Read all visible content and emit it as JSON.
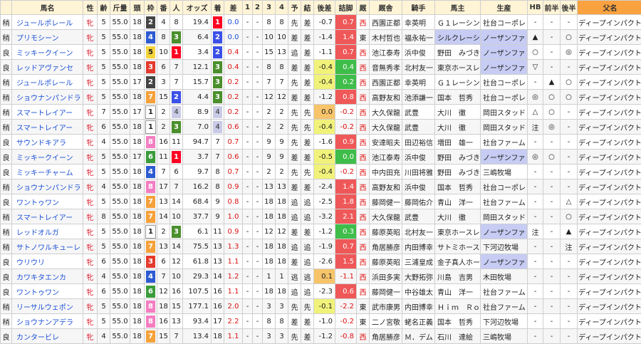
{
  "headers": [
    "馬名",
    "性",
    "齢",
    "斤量",
    "頭",
    "枠",
    "番",
    "人",
    "オッズ",
    "着",
    "差",
    "1",
    "2",
    "3",
    "4",
    "予",
    "結",
    "後差",
    "詰脚",
    "厩",
    "厩舎",
    "騎手",
    "馬主",
    "生産",
    "HB",
    "前半",
    "後半",
    "父名"
  ],
  "colors": {
    "waku": {
      "1": "#ffffff",
      "2": "#444444",
      "3": "#e53a2e",
      "4": "#2d5bd2",
      "5": "#f5d43a",
      "6": "#3a9c3a",
      "7": "#f6a13a",
      "8": "#f57ec2"
    }
  },
  "rows": [
    {
      "baba": "稍",
      "name": "ジュールポレール",
      "sex": "牝",
      "age": "5",
      "kin": "55.0",
      "tou": "18",
      "waku": "2",
      "ban": "4",
      "nin": "8",
      "odds": "19.4",
      "chaku": "1",
      "sa": "0.0",
      "c1": "-",
      "c2": "-",
      "c3": "8",
      "c4": "8",
      "yo": "先",
      "ke": "差",
      "atosa": "-0.7",
      "tsume": "0.7",
      "kyu": "西",
      "kyusha": "西園正都",
      "kishu": "幸英明",
      "banushi": "Ｇ１レーシン",
      "seisan": "社台コーポレ",
      "hb": "-",
      "zen": "-",
      "kou": "-",
      "chichi": "ディープインパクト"
    },
    {
      "baba": "稍",
      "name": "プリモシーン",
      "sex": "牝",
      "age": "5",
      "kin": "55.0",
      "tou": "18",
      "waku": "4",
      "ban": "8",
      "nin": "3",
      "odds": "6.4",
      "chaku": "2",
      "sa": "0.0",
      "c1": "-",
      "c2": "-",
      "c3": "10",
      "c4": "10",
      "yo": "差",
      "ke": "差",
      "atosa": "-1.4",
      "tsume": "1.4",
      "kyu": "東",
      "kyusha": "木村哲也",
      "kishu": "福永祐一",
      "banushi": "シルクレーシ",
      "seisan": "ノーザンファ",
      "hb": "▲",
      "zen": "-",
      "kou": "○",
      "chichi": "ディープインパクト"
    },
    {
      "baba": "良",
      "name": "ミッキークイーン",
      "sex": "牝",
      "age": "5",
      "kin": "55.0",
      "tou": "18",
      "waku": "5",
      "ban": "10",
      "nin": "1",
      "odds": "3.4",
      "chaku": "2",
      "sa": "0.4",
      "c1": "-",
      "c2": "-",
      "c3": "15",
      "c4": "13",
      "yo": "追",
      "ke": "差",
      "atosa": "-1.1",
      "tsume": "0.7",
      "kyu": "西",
      "kyusha": "池江泰寿",
      "kishu": "浜中俊",
      "banushi": "野田　みづき",
      "seisan": "ノーザンファ",
      "hb": "○",
      "zen": "-",
      "kou": "◎",
      "chichi": "ディープインパクト"
    },
    {
      "baba": "良",
      "name": "レッドアヴァンセ",
      "sex": "牝",
      "age": "5",
      "kin": "55.0",
      "tou": "18",
      "waku": "3",
      "ban": "6",
      "nin": "7",
      "odds": "12.1",
      "chaku": "3",
      "sa": "0.4",
      "c1": "-",
      "c2": "-",
      "c3": "8",
      "c4": "8",
      "yo": "差",
      "ke": "差",
      "atosa": "-0.4",
      "tsume": "0.4",
      "kyu": "西",
      "kyusha": "音無秀孝",
      "kishu": "北村友一",
      "banushi": "東京ホースレ",
      "seisan": "ノーザンファ",
      "hb": "▽",
      "zen": "-",
      "kou": "-",
      "chichi": "ディープインパクト"
    },
    {
      "baba": "稍",
      "name": "ジュールポレール",
      "sex": "牝",
      "age": "5",
      "kin": "55.0",
      "tou": "17",
      "waku": "2",
      "ban": "3",
      "nin": "7",
      "odds": "15.7",
      "chaku": "3",
      "sa": "0.2",
      "c1": "-",
      "c2": "-",
      "c3": "7",
      "c4": "7",
      "yo": "先",
      "ke": "差",
      "atosa": "-0.4",
      "tsume": "0.2",
      "kyu": "西",
      "kyusha": "西園正都",
      "kishu": "幸英明",
      "banushi": "Ｇ１レーシン",
      "seisan": "社台コーポレ",
      "hb": "-",
      "zen": "▲",
      "kou": "○",
      "chichi": "ディープインパクト"
    },
    {
      "baba": "稍",
      "name": "ショウナンパンドラ",
      "sex": "牝",
      "age": "5",
      "kin": "55.0",
      "tou": "18",
      "waku": "7",
      "ban": "15",
      "nin": "2",
      "odds": "4.4",
      "chaku": "3",
      "sa": "0.2",
      "c1": "-",
      "c2": "-",
      "c3": "12",
      "c4": "12",
      "yo": "差",
      "ke": "差",
      "atosa": "-1.2",
      "tsume": "0.8",
      "kyu": "西",
      "kyusha": "高野友和",
      "kishu": "池添謙一",
      "banushi": "国本　哲秀",
      "seisan": "社台コーポレ",
      "hb": "◎",
      "zen": "○",
      "kou": "○",
      "chichi": "ディープインパクト"
    },
    {
      "baba": "稍",
      "name": "スマートレイアー",
      "sex": "牝",
      "age": "7",
      "kin": "55.0",
      "tou": "17",
      "waku": "1",
      "ban": "2",
      "nin": "4",
      "odds": "8.9",
      "chaku": "4",
      "sa": "0.2",
      "c1": "-",
      "c2": "-",
      "c3": "2",
      "c4": "2",
      "yo": "先",
      "ke": "先",
      "atosa": "0.0",
      "tsume": "-0.2",
      "kyu": "西",
      "kyusha": "大久保龍",
      "kishu": "武豊",
      "banushi": "大川　徹",
      "seisan": "岡田スタッド",
      "hb": "△",
      "zen": "○",
      "kou": "-",
      "chichi": "ディープインパクト"
    },
    {
      "baba": "稍",
      "name": "スマートレイアー",
      "sex": "牝",
      "age": "6",
      "kin": "55.0",
      "tou": "18",
      "waku": "1",
      "ban": "2",
      "nin": "3",
      "odds": "7.0",
      "chaku": "4",
      "sa": "0.6",
      "c1": "-",
      "c2": "-",
      "c3": "2",
      "c4": "2",
      "yo": "先",
      "ke": "先",
      "atosa": "-0.4",
      "tsume": "-0.2",
      "kyu": "西",
      "kyusha": "大久保龍",
      "kishu": "武豊",
      "banushi": "大川　徹",
      "seisan": "岡田スタッド",
      "hb": "注",
      "zen": "◎",
      "kou": "-",
      "chichi": "ディープインパクト"
    },
    {
      "baba": "良",
      "name": "サウンドキアラ",
      "sex": "牝",
      "age": "4",
      "kin": "55.0",
      "tou": "18",
      "waku": "8",
      "ban": "16",
      "nin": "11",
      "odds": "94.7",
      "chaku": "7",
      "sa": "0.7",
      "c1": "-",
      "c2": "-",
      "c3": "9",
      "c4": "9",
      "yo": "先",
      "ke": "差",
      "atosa": "-1.6",
      "tsume": "0.9",
      "kyu": "西",
      "kyusha": "安達昭夫",
      "kishu": "田辺裕信",
      "banushi": "増田　雄一",
      "seisan": "社台ファーム",
      "hb": "-",
      "zen": "-",
      "kou": "-",
      "chichi": "ディープインパクト"
    },
    {
      "baba": "良",
      "name": "ミッキークイーン",
      "sex": "牝",
      "age": "5",
      "kin": "55.0",
      "tou": "17",
      "waku": "6",
      "ban": "11",
      "nin": "1",
      "odds": "3.7",
      "chaku": "7",
      "sa": "0.6",
      "c1": "-",
      "c2": "-",
      "c3": "9",
      "c4": "9",
      "yo": "差",
      "ke": "差",
      "atosa": "-0.5",
      "tsume": "0.0",
      "kyu": "西",
      "kyusha": "池江泰寿",
      "kishu": "浜中俊",
      "banushi": "野田　みづき",
      "seisan": "ノーザンファ",
      "hb": "◎",
      "zen": "○",
      "kou": "-",
      "chichi": "ディープインパクト"
    },
    {
      "baba": "良",
      "name": "ミッキーチャーム",
      "sex": "牝",
      "age": "5",
      "kin": "55.0",
      "tou": "18",
      "waku": "4",
      "ban": "7",
      "nin": "6",
      "odds": "9.7",
      "chaku": "8",
      "sa": "0.7",
      "c1": "-",
      "c2": "-",
      "c3": "2",
      "c4": "2",
      "yo": "先",
      "ke": "先",
      "atosa": "-0.4",
      "tsume": "-0.2",
      "kyu": "西",
      "kyusha": "中内田充",
      "kishu": "川田将雅",
      "banushi": "野田　みづき",
      "seisan": "三嶋牧場",
      "hb": "-",
      "zen": "-",
      "kou": "-",
      "chichi": "ディープインパクト"
    },
    {
      "baba": "稍",
      "name": "ショウナンパンドラ",
      "sex": "牝",
      "age": "4",
      "kin": "55.0",
      "tou": "18",
      "waku": "8",
      "ban": "17",
      "nin": "7",
      "odds": "16.2",
      "chaku": "8",
      "sa": "0.9",
      "c1": "-",
      "c2": "-",
      "c3": "13",
      "c4": "13",
      "yo": "差",
      "ke": "差",
      "atosa": "-2.4",
      "tsume": "1.4",
      "kyu": "西",
      "kyusha": "高野友和",
      "kishu": "浜中俊",
      "banushi": "国本　哲秀",
      "seisan": "社台コーポレ",
      "hb": "-",
      "zen": "-",
      "kou": "-",
      "chichi": "ディープインパクト"
    },
    {
      "baba": "良",
      "name": "ワントゥワン",
      "sex": "牝",
      "age": "5",
      "kin": "55.0",
      "tou": "18",
      "waku": "7",
      "ban": "13",
      "nin": "14",
      "odds": "68.4",
      "chaku": "9",
      "sa": "0.8",
      "c1": "-",
      "c2": "-",
      "c3": "18",
      "c4": "18",
      "yo": "追",
      "ke": "追",
      "atosa": "-2.5",
      "tsume": "1.8",
      "kyu": "西",
      "kyusha": "藤岡健一",
      "kishu": "藤岡佑介",
      "banushi": "青山　洋一",
      "seisan": "社台ファーム",
      "hb": "-",
      "zen": "-",
      "kou": "△",
      "chichi": "ディープインパクト"
    },
    {
      "baba": "稍",
      "name": "スマートレイアー",
      "sex": "牝",
      "age": "8",
      "kin": "55.0",
      "tou": "18",
      "waku": "7",
      "ban": "14",
      "nin": "10",
      "odds": "37.7",
      "chaku": "9",
      "sa": "1.0",
      "c1": "-",
      "c2": "-",
      "c3": "18",
      "c4": "18",
      "yo": "追",
      "ke": "追",
      "atosa": "-3.2",
      "tsume": "2.1",
      "kyu": "西",
      "kyusha": "大久保龍",
      "kishu": "武豊",
      "banushi": "大川　徹",
      "seisan": "岡田スタッド",
      "hb": "-",
      "zen": "-",
      "kou": "○",
      "chichi": "ディープインパクト"
    },
    {
      "baba": "稍",
      "name": "レッドオルガ",
      "sex": "牝",
      "age": "5",
      "kin": "55.0",
      "tou": "18",
      "waku": "1",
      "ban": "2",
      "nin": "3",
      "odds": "6.1",
      "chaku": "11",
      "sa": "0.9",
      "c1": "-",
      "c2": "-",
      "c3": "12",
      "c4": "12",
      "yo": "差",
      "ke": "差",
      "atosa": "-1.2",
      "tsume": "0.3",
      "kyu": "西",
      "kyusha": "藤原英昭",
      "kishu": "北村友一",
      "banushi": "東京ホースレ",
      "seisan": "ノーザンファ",
      "hb": "注",
      "zen": "-",
      "kou": "▲",
      "chichi": "ディープインパクト"
    },
    {
      "baba": "稍",
      "name": "サトノワルキューレ",
      "sex": "牝",
      "age": "5",
      "kin": "55.0",
      "tou": "18",
      "waku": "7",
      "ban": "13",
      "nin": "14",
      "odds": "75.5",
      "chaku": "13",
      "sa": "1.3",
      "c1": "-",
      "c2": "-",
      "c3": "18",
      "c4": "18",
      "yo": "追",
      "ke": "追",
      "atosa": "-1.9",
      "tsume": "0.7",
      "kyu": "西",
      "kyusha": "角居勝彦",
      "kishu": "内田博幸",
      "banushi": "サトミホース",
      "seisan": "下河辺牧場",
      "hb": "-",
      "zen": "-",
      "kou": "注",
      "chichi": "ディープインパクト"
    },
    {
      "baba": "良",
      "name": "ウリウリ",
      "sex": "牝",
      "age": "6",
      "kin": "55.0",
      "tou": "18",
      "waku": "3",
      "ban": "6",
      "nin": "12",
      "odds": "61.8",
      "chaku": "13",
      "sa": "1.1",
      "c1": "-",
      "c2": "-",
      "c3": "18",
      "c4": "18",
      "yo": "差",
      "ke": "追",
      "atosa": "-2.6",
      "tsume": "1.5",
      "kyu": "西",
      "kyusha": "藤原英昭",
      "kishu": "三浦皇成",
      "banushi": "金子真人ホー",
      "seisan": "ノーザンファ",
      "hb": "-",
      "zen": "-",
      "kou": "-",
      "chichi": "ディープインパクト"
    },
    {
      "baba": "良",
      "name": "カワキタエンカ",
      "sex": "牝",
      "age": "4",
      "kin": "55.0",
      "tou": "18",
      "waku": "4",
      "ban": "7",
      "nin": "10",
      "odds": "29.3",
      "chaku": "14",
      "sa": "1.2",
      "c1": "-",
      "c2": "-",
      "c3": "1",
      "c4": "1",
      "yo": "逃",
      "ke": "逃",
      "atosa": "0.1",
      "tsume": "-1.1",
      "kyu": "西",
      "kyusha": "浜田多実",
      "kishu": "大野拓弥",
      "banushi": "川島　吉男",
      "seisan": "木田牧場",
      "hb": "-",
      "zen": "-",
      "kou": "-",
      "chichi": "ディープインパクト"
    },
    {
      "baba": "良",
      "name": "ワントゥワン",
      "sex": "牝",
      "age": "6",
      "kin": "55.0",
      "tou": "18",
      "waku": "6",
      "ban": "12",
      "nin": "16",
      "odds": "107.5",
      "chaku": "16",
      "sa": "1.1",
      "c1": "-",
      "c2": "-",
      "c3": "18",
      "c4": "18",
      "yo": "追",
      "ke": "追",
      "atosa": "-2.3",
      "tsume": "0.6",
      "kyu": "西",
      "kyusha": "藤岡健一",
      "kishu": "中谷雄太",
      "banushi": "青山　洋一",
      "seisan": "社台ファーム",
      "hb": "-",
      "zen": "-",
      "kou": "-",
      "chichi": "ディープインパクト"
    },
    {
      "baba": "稍",
      "name": "リーサルウェポン",
      "sex": "牝",
      "age": "5",
      "kin": "55.0",
      "tou": "18",
      "waku": "8",
      "ban": "18",
      "nin": "15",
      "odds": "177.1",
      "chaku": "16",
      "sa": "2.0",
      "c1": "-",
      "c2": "-",
      "c3": "3",
      "c4": "3",
      "yo": "先",
      "ke": "先",
      "atosa": "-0.1",
      "tsume": "-2.2",
      "kyu": "東",
      "kyusha": "武市康男",
      "kishu": "内田博幸",
      "banushi": "Ｈｉｍ　Ｒｏ",
      "seisan": "社台ファーム",
      "hb": "-",
      "zen": "-",
      "kou": "-",
      "chichi": "ディープインパクト"
    },
    {
      "baba": "稍",
      "name": "ショウナンアデラ",
      "sex": "牝",
      "age": "5",
      "kin": "55.0",
      "tou": "18",
      "waku": "8",
      "ban": "16",
      "nin": "13",
      "odds": "93.4",
      "chaku": "17",
      "sa": "2.2",
      "c1": "-",
      "c2": "-",
      "c3": "8",
      "c4": "8",
      "yo": "差",
      "ke": "差",
      "atosa": "-1.0",
      "tsume": "-0.2",
      "kyu": "東",
      "kyusha": "二ノ宮敬",
      "kishu": "蛯名正義",
      "banushi": "国本　哲秀",
      "seisan": "下河辺牧場",
      "hb": "-",
      "zen": "-",
      "kou": "-",
      "chichi": "ディープインパクト"
    },
    {
      "baba": "良",
      "name": "カンタービレ",
      "sex": "牝",
      "age": "4",
      "kin": "55.0",
      "tou": "18",
      "waku": "7",
      "ban": "15",
      "nin": "7",
      "odds": "13.4",
      "chaku": "18",
      "sa": "1.1",
      "c1": "-",
      "c2": "-",
      "c3": "3",
      "c4": "3",
      "yo": "先",
      "ke": "差",
      "atosa": "-1.2",
      "tsume": "-0.8",
      "kyu": "西",
      "kyusha": "角居勝彦",
      "kishu": "Ｍ．デム",
      "banushi": "石川　達絵",
      "seisan": "三嶋牧場",
      "hb": "-",
      "zen": "-",
      "kou": "-",
      "chichi": "ディープインパクト"
    }
  ]
}
